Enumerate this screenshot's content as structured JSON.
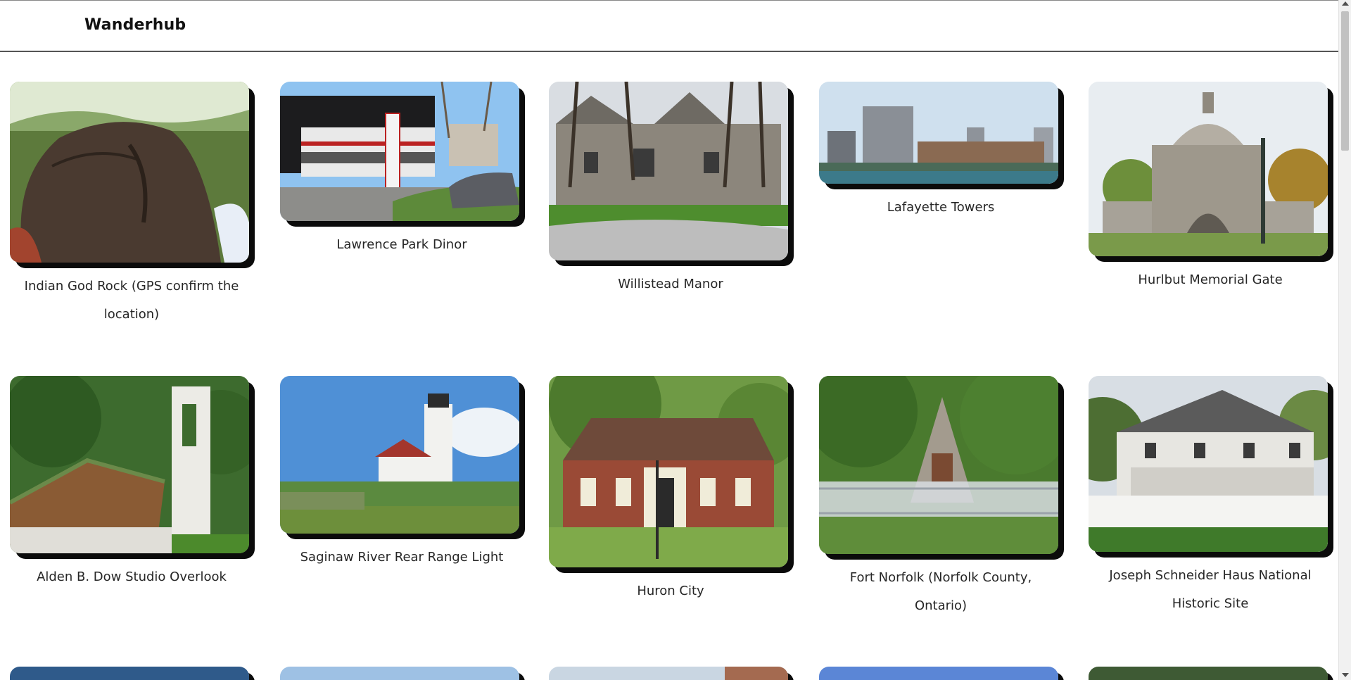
{
  "app": {
    "brand": "Wanderhub"
  },
  "places": [
    {
      "name": "Indian God Rock (GPS confirm the location)",
      "icon": "rock-photo"
    },
    {
      "name": "Lawrence Park Dinor",
      "icon": "diner-photo"
    },
    {
      "name": "Willistead Manor",
      "icon": "manor-photo"
    },
    {
      "name": "Lafayette Towers",
      "icon": "skyline-photo"
    },
    {
      "name": "Hurlbut Memorial Gate",
      "icon": "gate-photo"
    },
    {
      "name": "Alden B. Dow Studio Overlook",
      "icon": "studio-photo"
    },
    {
      "name": "Saginaw River Rear Range Light",
      "icon": "lighthouse-photo"
    },
    {
      "name": "Huron City",
      "icon": "brick-house-photo"
    },
    {
      "name": "Fort Norfolk (Norfolk County, Ontario)",
      "icon": "monument-photo"
    },
    {
      "name": "Joseph Schneider Haus National Historic Site",
      "icon": "farmhouse-photo"
    }
  ]
}
